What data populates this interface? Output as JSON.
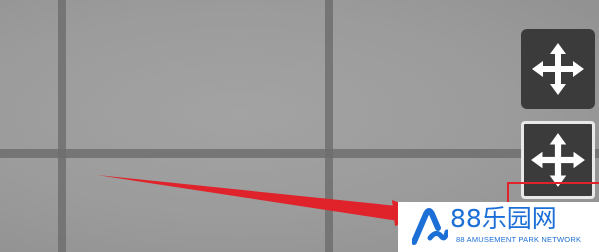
{
  "scene": {
    "background_color": "#9a9a9a",
    "grid_color": "#6e6e6e"
  },
  "controls": {
    "move_button_primary": {
      "icon": "move-arrows-icon",
      "color": "#3b3b3b"
    },
    "move_button_secondary": {
      "icon": "move-arrows-icon",
      "color": "#3b3b3b"
    }
  },
  "annotation": {
    "arrow_color": "#e0222a",
    "highlight_color": "#e0222a"
  },
  "watermark": {
    "title": "88乐园网",
    "subtitle": "88 AMUSEMENT PARK NETWORK",
    "logo": "wave-a-logo",
    "color": "#1c6fd6"
  }
}
